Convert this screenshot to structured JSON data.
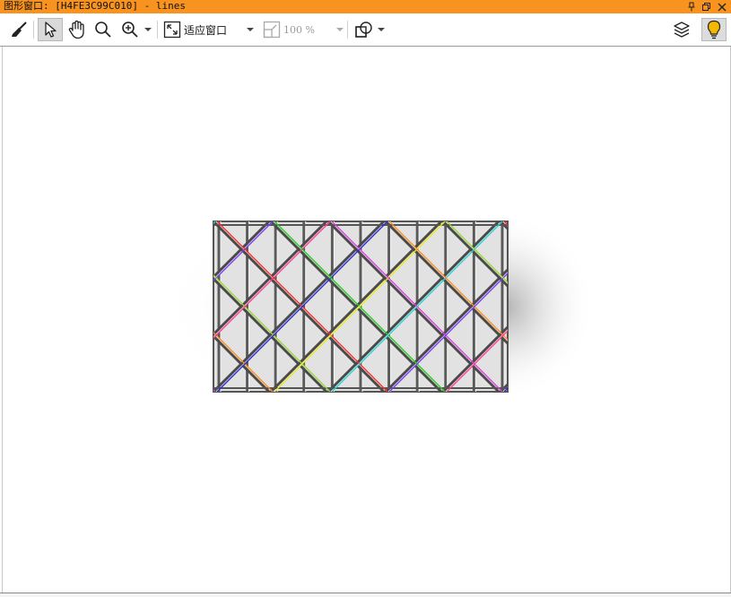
{
  "window": {
    "title": "图形窗口: [H4FE3C99C010] - lines",
    "title_bar_color": "#f7931e"
  },
  "title_buttons": [
    {
      "icon": "pin-icon"
    },
    {
      "icon": "restore-icon"
    },
    {
      "icon": "close-icon"
    }
  ],
  "toolbar": {
    "tools": [
      "broom-icon",
      "pointer-icon",
      "pan-hand-icon",
      "search-icon",
      "zoom-in-icon"
    ],
    "active_tool": "pointer-icon",
    "fit_mode_label": "适应窗口",
    "zoom_label": "100 %",
    "zoom_enabled": false,
    "right_icons": [
      "layers-icon",
      "lightbulb-icon"
    ]
  },
  "canvas": {
    "background": "#ffffff",
    "line_colors": [
      "#ff2a2a",
      "#2b2bd6",
      "#1fcf1f",
      "#e8e81a",
      "#e03ae0",
      "#2ad0d0",
      "#ff8a1a",
      "#7a3aff",
      "#9ad02a",
      "#ff3a90"
    ]
  }
}
